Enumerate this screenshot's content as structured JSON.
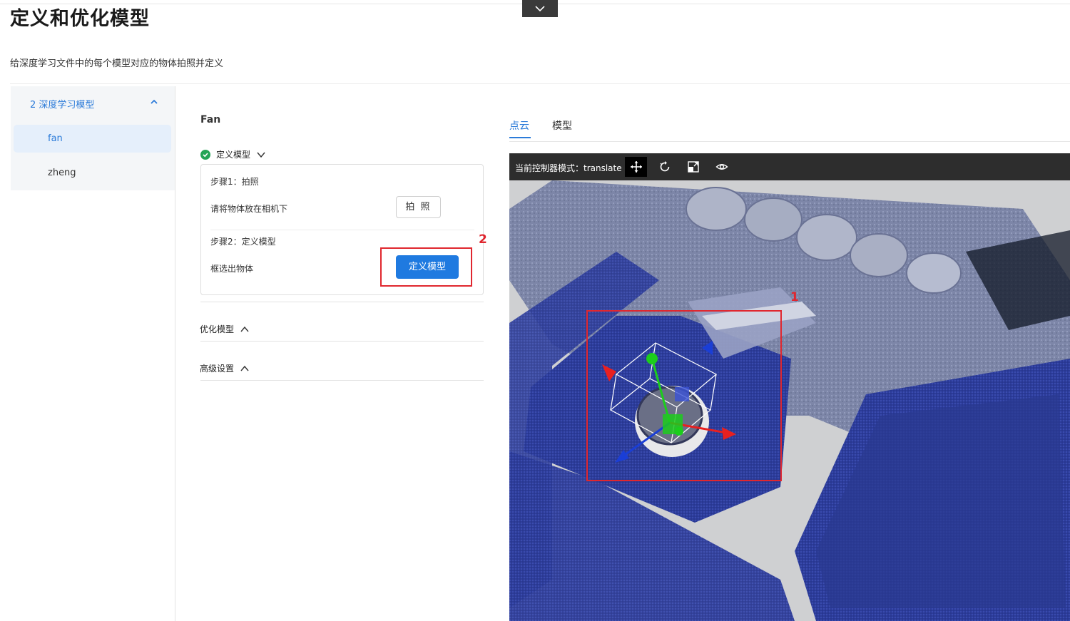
{
  "header": {
    "title": "定义和优化模型",
    "subtitle": "给深度学习文件中的每个模型对应的物体拍照并定义"
  },
  "sidebar": {
    "group_label": "2 深度学习模型",
    "items": [
      {
        "label": "fan",
        "active": true
      },
      {
        "label": "zheng",
        "active": false
      }
    ]
  },
  "panel": {
    "model_name": "Fan",
    "define_section": {
      "label": "定义模型",
      "status": "done",
      "steps": [
        {
          "title": "步骤1：拍照",
          "desc": "请将物体放在相机下",
          "button": "拍 照"
        },
        {
          "title": "步骤2：定义模型",
          "desc": "框选出物体",
          "button": "定义模型"
        }
      ]
    },
    "optimize_section": {
      "label": "优化模型"
    },
    "advanced_section": {
      "label": "高级设置"
    },
    "marker_2": "2"
  },
  "viewer": {
    "tabs": [
      {
        "label": "点云",
        "active": true
      },
      {
        "label": "模型",
        "active": false
      }
    ],
    "mode_text": "当前控制器模式：translate",
    "tools": [
      {
        "icon": "move-icon",
        "active": true
      },
      {
        "icon": "rotate-icon",
        "active": false
      },
      {
        "icon": "scale-icon",
        "active": false
      },
      {
        "icon": "eye-icon",
        "active": false
      }
    ],
    "marker_1": "1"
  },
  "colors": {
    "accent": "#1f7ae0",
    "link": "#2b7bd9",
    "success": "#23a455",
    "annotation": "#e0272f",
    "toolbar_bg": "#2d2d2d",
    "cloud_blue": "#2f3f9e"
  }
}
